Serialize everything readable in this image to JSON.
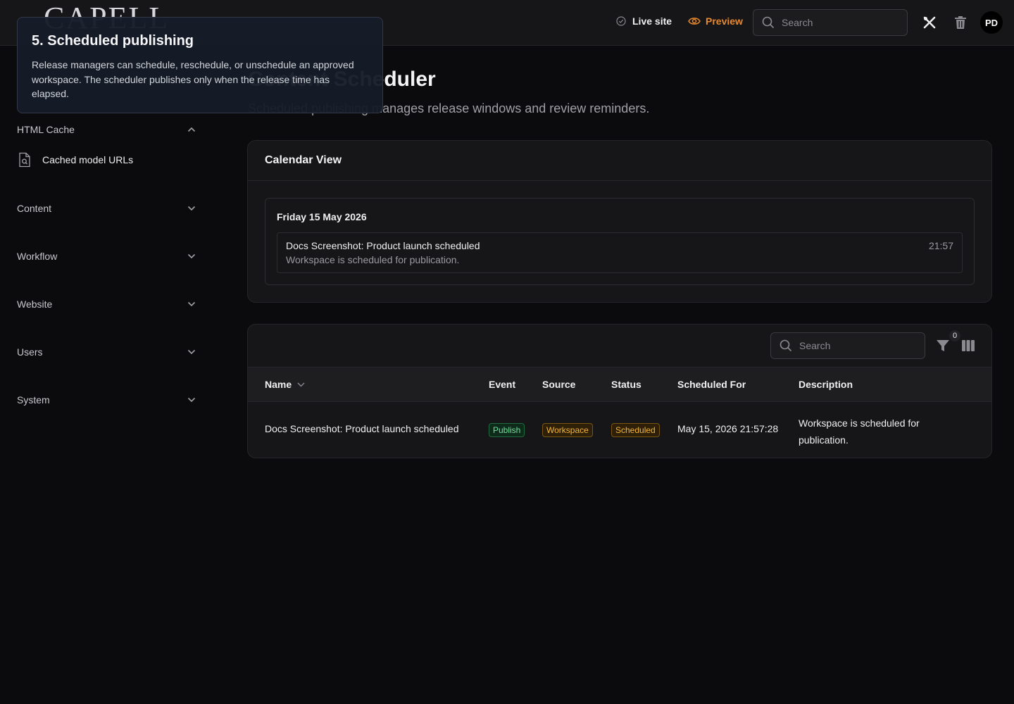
{
  "header": {
    "logo": "CAPELL",
    "live_site": "Live site",
    "preview": "Preview",
    "search_placeholder": "Search",
    "avatar_initials": "PD"
  },
  "sidebar": {
    "groups": [
      {
        "label": "HTML Cache",
        "expanded": true,
        "items": [
          {
            "label": "Cached model URLs"
          }
        ]
      },
      {
        "label": "Content",
        "expanded": false
      },
      {
        "label": "Workflow",
        "expanded": false
      },
      {
        "label": "Website",
        "expanded": false
      },
      {
        "label": "Users",
        "expanded": false
      },
      {
        "label": "System",
        "expanded": false
      }
    ]
  },
  "page": {
    "title": "Content Scheduler",
    "subtitle": "Scheduled publishing manages release windows and review reminders."
  },
  "calendar": {
    "heading": "Calendar View",
    "day": "Friday 15 May 2026",
    "event": {
      "title": "Docs Screenshot: Product launch scheduled",
      "description": "Workspace is scheduled for publication.",
      "time": "21:57"
    }
  },
  "table": {
    "search_placeholder": "Search",
    "filter_count": "0",
    "columns": [
      "Name",
      "Event",
      "Source",
      "Status",
      "Scheduled For",
      "Description"
    ],
    "rows": [
      {
        "name": "Docs Screenshot: Product launch scheduled",
        "event": "Publish",
        "source": "Workspace",
        "status": "Scheduled",
        "scheduled_for": "May 15, 2026 21:57:28",
        "description_line1": "Workspace is scheduled for",
        "description_line2": "publication."
      }
    ]
  },
  "tour": {
    "title": "5. Scheduled publishing",
    "body": "Release managers can schedule, reschedule, or unschedule an approved workspace. The scheduler publishes only when the release time has elapsed."
  },
  "colors": {
    "accent": "#e8892f",
    "badge_green": "#6fe39a",
    "badge_amber": "#f3b53c"
  }
}
